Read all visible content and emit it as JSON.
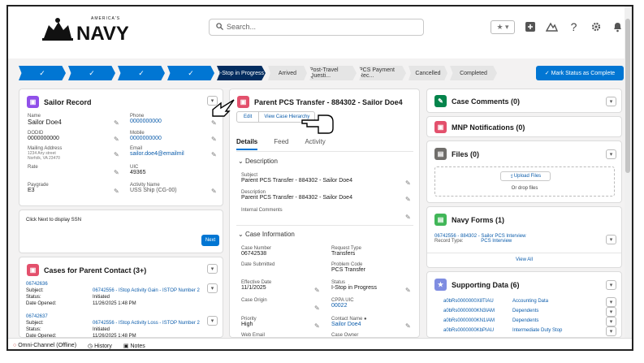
{
  "header": {
    "logo_text": "NAVY",
    "logo_sup": "AMERICA'S",
    "search_placeholder": "Search...",
    "fav_label": "★ ▾"
  },
  "icons": {
    "search": "search-icon",
    "add": "add-icon",
    "help": "help-icon",
    "settings": "gear-icon",
    "bell": "bell-icon",
    "trailhead": "trailhead-icon",
    "avatar": "avatar-icon"
  },
  "path": {
    "stages": [
      {
        "label": "✓",
        "state": "done"
      },
      {
        "label": "✓",
        "state": "done"
      },
      {
        "label": "✓",
        "state": "done"
      },
      {
        "label": "✓",
        "state": "done"
      },
      {
        "label": "I-Stop in Progress",
        "state": "current"
      },
      {
        "label": "Arrived",
        "state": "todo"
      },
      {
        "label": "Post-Travel Questi...",
        "state": "todo"
      },
      {
        "label": "PCS Payment Rec...",
        "state": "todo"
      },
      {
        "label": "Cancelled",
        "state": "todo"
      },
      {
        "label": "Completed",
        "state": "todo"
      }
    ],
    "mark_button": "✓ Mark Status as Complete"
  },
  "sailor": {
    "title": "Sailor Record",
    "name_label": "Name",
    "name": "Sailor Doe4",
    "phone_label": "Phone",
    "phone": "0000000000",
    "dodid_label": "DODID",
    "dodid": "0000000000",
    "mobile_label": "Mobile",
    "mobile": "0000000000",
    "mailing_label": "Mailing Address",
    "mailing": "1234 Any street\nNorfolk, VA 23470",
    "email_label": "Email",
    "email": "sailor.doe4@emailmil",
    "rate_label": "Rate",
    "rate": "",
    "uic_label": "UIC",
    "uic": "49365",
    "paygrade_label": "Paygrade",
    "paygrade": "E3",
    "activity_label": "Activity Name",
    "activity": "USS Ship (CG-00)"
  },
  "ssn": {
    "text": "Click Next to display SSN",
    "next": "Next"
  },
  "cases": {
    "title": "Cases for Parent Contact (3+)",
    "items": [
      {
        "id": "06742636",
        "subject_label": "Subject:",
        "subject": "06742556 - IStop Activity Gain - ISTOP Number 2",
        "status_label": "Status:",
        "status": "Initiated",
        "opened_label": "Date Opened:",
        "opened": "11/26/2025 1:48 PM"
      },
      {
        "id": "06742637",
        "subject_label": "Subject:",
        "subject": "06742556 - IStop Activity Loss - ISTOP Number 2",
        "status_label": "Status:",
        "status": "Initiated",
        "opened_label": "Date Opened:",
        "opened": "11/26/2025 1:48 PM"
      }
    ]
  },
  "case": {
    "title": "Parent PCS Transfer - 884302 - Sailor Doe4",
    "edit": "Edit",
    "view_hierarchy": "View Case Hierarchy",
    "tabs": [
      "Details",
      "Feed",
      "Activity"
    ],
    "desc_section": "Description",
    "subject_label": "Subject",
    "subject": "Parent PCS Transfer - 884302 - Sailor Doe4",
    "description_label": "Description",
    "description": "Parent PCS Transfer - 884302 - Sailor Doe4",
    "internal_label": "Internal Comments",
    "internal": "",
    "info_section": "Case Information",
    "case_number_label": "Case Number",
    "case_number": "06742538",
    "request_type_label": "Request Type",
    "request_type": "Transfers",
    "date_submitted_label": "Date Submitted",
    "date_submitted": "",
    "problem_code_label": "Problem Code",
    "problem_code": "PCS Transfer",
    "effective_label": "Effective Date",
    "effective": "11/1/2025",
    "status_label": "Status",
    "status": "I-Stop in Progress",
    "origin_label": "Case Origin",
    "origin": "",
    "cppa_label": "CPPA UIC",
    "cppa": "00022",
    "priority_label": "Priority",
    "priority": "High",
    "contact_label": "Contact Name",
    "contact": "Sailor Doe4",
    "web_email_label": "Web Email",
    "owner_label": "Case Owner"
  },
  "right": {
    "comments": "Case Comments (0)",
    "mnp": "MNP Notifications (0)",
    "files": "Files (0)",
    "upload": "Upload Files",
    "drop": "Or drop files",
    "forms": "Navy Forms (1)",
    "form_link": "06742556 - 884302 - Sailor PCS Interview",
    "record_type_label": "Record Type:",
    "record_type": "PCS Interview",
    "view_all": "View All",
    "supporting": "Supporting Data (6)",
    "support_rows": [
      {
        "id": "a0bRs0000000X8TIAU",
        "type": "Accounting Data"
      },
      {
        "id": "a0bRs0000000KN3IAM",
        "type": "Dependents"
      },
      {
        "id": "a0bRs0000000KN1IAM",
        "type": "Dependents"
      },
      {
        "id": "a0bRs0000000KbPIAU",
        "type": "Intermediate Duty Stop"
      }
    ]
  },
  "footer": {
    "omni": "Omni-Channel (Offline)",
    "history": "History",
    "notes": "Notes"
  },
  "colors": {
    "brand": "#0176d3",
    "current_stage": "#032d60",
    "case_icon": "#e3506c",
    "comments_icon": "#04844b",
    "forms_icon": "#41b658",
    "support_icon": "#7f8de1",
    "files_icon": "#706e6b",
    "mnp_icon": "#e3506c"
  }
}
